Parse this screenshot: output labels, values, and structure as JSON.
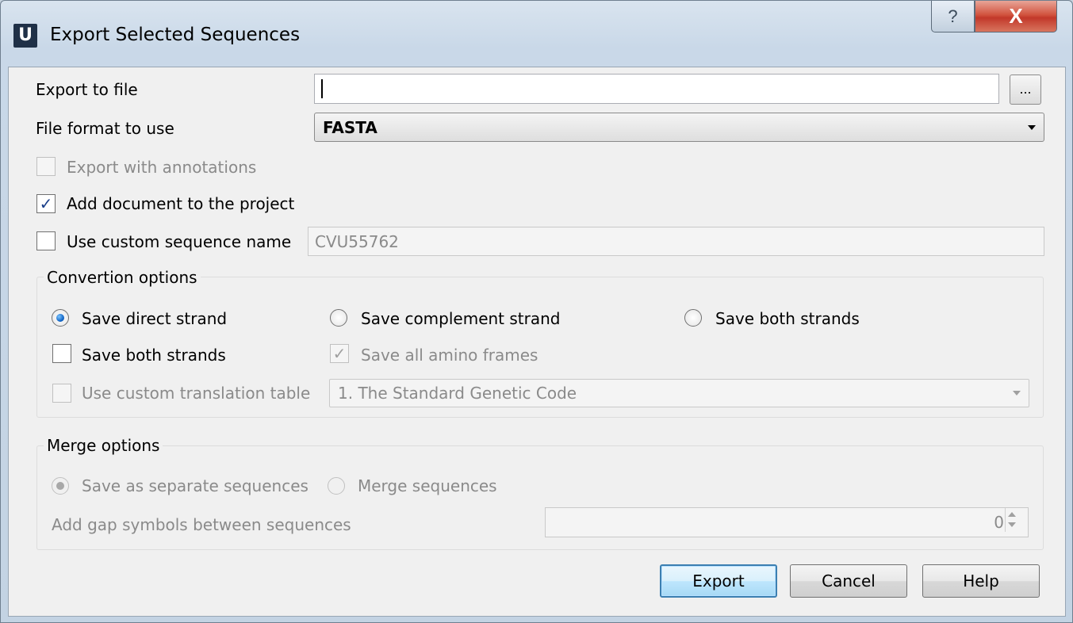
{
  "window": {
    "title": "Export Selected Sequences",
    "app_icon_letter": "U",
    "help_glyph": "?",
    "close_glyph": "X"
  },
  "export_file": {
    "label": "Export to file",
    "value": "",
    "browse_label": "..."
  },
  "file_format": {
    "label": "File format to use",
    "selected": "FASTA"
  },
  "options": {
    "export_with_annotations": {
      "label": "Export with annotations",
      "checked": false,
      "enabled": false
    },
    "add_to_project": {
      "label": "Add document to the project",
      "checked": true,
      "check_glyph": "✓"
    },
    "custom_name": {
      "label": "Use custom sequence name",
      "checked": false,
      "value": "CVU55762"
    }
  },
  "conversion": {
    "title": "Convertion options",
    "radio_direct": "Save direct strand",
    "radio_complement": "Save complement strand",
    "radio_both": "Save both strands",
    "check_both": "Save both strands",
    "check_amino": "Save all amino frames",
    "amino_glyph": "✓",
    "check_translation": "Use custom translation table",
    "translation_table": "1. The Standard Genetic Code"
  },
  "merge": {
    "title": "Merge options",
    "radio_separate": "Save as separate sequences",
    "radio_merge": "Merge sequences",
    "gap_label": "Add gap symbols between sequences",
    "gap_value": "0"
  },
  "buttons": {
    "export": "Export",
    "cancel": "Cancel",
    "help": "Help"
  }
}
